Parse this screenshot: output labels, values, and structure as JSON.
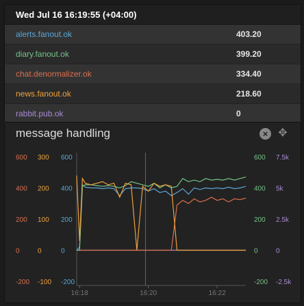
{
  "tooltip": {
    "timestamp": "Wed Jul 16 16:19:55 (+04:00)",
    "rows": [
      {
        "label": "alerts.fanout.ok",
        "value": "403.20",
        "color": "#5aa6d6"
      },
      {
        "label": "diary.fanout.ok",
        "value": "399.20",
        "color": "#76c28a"
      },
      {
        "label": "chat.denormalizer.ok",
        "value": "334.40",
        "color": "#d9704f"
      },
      {
        "label": "news.fanout.ok",
        "value": "218.60",
        "color": "#f0a23c"
      },
      {
        "label": "rabbit.pub.ok",
        "value": "0",
        "color": "#a98bd4"
      }
    ]
  },
  "graph": {
    "title": "message handling",
    "close_icon": "close-icon",
    "move_icon": "move-icon"
  },
  "chart_data": {
    "type": "line",
    "x_ticks": [
      "16:18",
      "16:20",
      "16:22"
    ],
    "axes": [
      {
        "side": "left",
        "color": "#d9704f",
        "ticks": [
          "600",
          "400",
          "200",
          "0",
          "-200"
        ]
      },
      {
        "side": "left",
        "color": "#f0a23c",
        "ticks": [
          "300",
          "200",
          "100",
          "0",
          "-100"
        ]
      },
      {
        "side": "left",
        "color": "#5aa6d6",
        "ticks": [
          "600",
          "400",
          "200",
          "0",
          "-200"
        ]
      },
      {
        "side": "right",
        "color": "#76c28a",
        "ticks": [
          "600",
          "400",
          "200",
          "0",
          "-200"
        ]
      },
      {
        "side": "right",
        "color": "#a98bd4",
        "ticks": [
          "7.5k",
          "5k",
          "2.5k",
          "0",
          "-2.5k"
        ]
      }
    ],
    "series": [
      {
        "name": "alerts.fanout.ok",
        "color": "#5aa6d6",
        "axis": 2
      },
      {
        "name": "diary.fanout.ok",
        "color": "#76c28a",
        "axis": 3
      },
      {
        "name": "chat.denormalizer.ok",
        "color": "#d9704f",
        "axis": 0
      },
      {
        "name": "news.fanout.ok",
        "color": "#f0a23c",
        "axis": 1
      },
      {
        "name": "rabbit.pub.ok",
        "color": "#a98bd4",
        "axis": 4
      }
    ],
    "x": [
      "16:17:55",
      "16:18:00",
      "16:18:05",
      "16:18:10",
      "16:18:20",
      "16:18:30",
      "16:18:40",
      "16:18:50",
      "16:19:00",
      "16:19:10",
      "16:19:20",
      "16:19:30",
      "16:19:40",
      "16:19:50",
      "16:20:00",
      "16:20:10",
      "16:20:20",
      "16:20:30",
      "16:20:40",
      "16:20:50",
      "16:21:00",
      "16:21:10",
      "16:21:20",
      "16:21:30",
      "16:21:40",
      "16:21:50",
      "16:22:00",
      "16:22:10",
      "16:22:20",
      "16:22:30",
      "16:22:40",
      "16:22:50"
    ],
    "values": {
      "alerts.fanout.ok": [
        0,
        20,
        420,
        405,
        400,
        400,
        395,
        400,
        395,
        350,
        395,
        400,
        400,
        395,
        380,
        395,
        370,
        380,
        350,
        370,
        395,
        360,
        400,
        390,
        400,
        395,
        400,
        395,
        405,
        395,
        400,
        410
      ],
      "diary.fanout.ok": [
        0,
        0,
        410,
        420,
        420,
        415,
        410,
        415,
        410,
        400,
        415,
        440,
        430,
        420,
        410,
        430,
        400,
        420,
        400,
        410,
        460,
        440,
        450,
        440,
        460,
        450,
        455,
        450,
        460,
        450,
        460,
        470
      ],
      "chat.denormalizer.ok": [
        0,
        0,
        0,
        0,
        0,
        0,
        0,
        0,
        0,
        0,
        0,
        0,
        0,
        0,
        0,
        0,
        0,
        0,
        0,
        290,
        320,
        300,
        330,
        310,
        320,
        340,
        320,
        330,
        310,
        330,
        325,
        335
      ],
      "news.fanout.ok": [
        240,
        30,
        230,
        215,
        210,
        215,
        220,
        210,
        215,
        170,
        215,
        210,
        0,
        205,
        190,
        215,
        205,
        210,
        205,
        0,
        0,
        0,
        0,
        0,
        0,
        0,
        0,
        0,
        0,
        0,
        0,
        0
      ],
      "rabbit.pub.ok": [
        0,
        0,
        0,
        0,
        0,
        0,
        0,
        0,
        0,
        0,
        0,
        0,
        0,
        0,
        0,
        0,
        0,
        0,
        0,
        0,
        0,
        0,
        0,
        0,
        0,
        0,
        0,
        0,
        0,
        0,
        0,
        0
      ]
    },
    "cursor_x": "16:19:55",
    "grid": false
  }
}
